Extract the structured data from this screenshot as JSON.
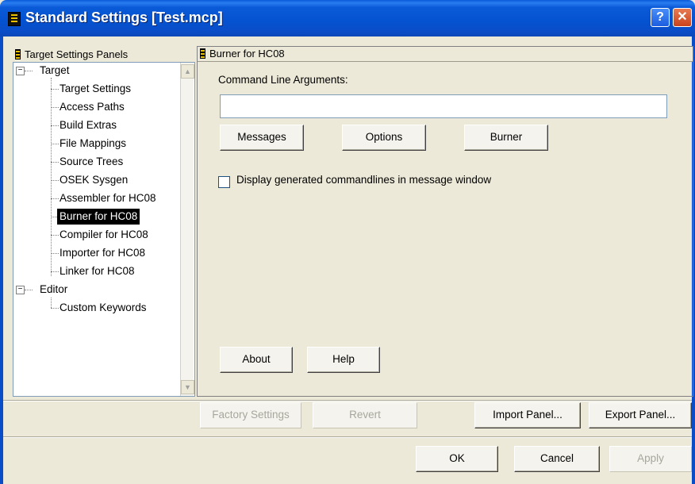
{
  "window": {
    "title": "Standard Settings [Test.mcp]",
    "help_glyph": "?",
    "close_glyph": "✕"
  },
  "left_panel": {
    "header": "Target Settings Panels",
    "tree": [
      {
        "label": "Target",
        "level": 0,
        "expander": "−"
      },
      {
        "label": "Target Settings",
        "level": 1
      },
      {
        "label": "Access Paths",
        "level": 1
      },
      {
        "label": "Build Extras",
        "level": 1
      },
      {
        "label": "File Mappings",
        "level": 1
      },
      {
        "label": "Source Trees",
        "level": 1
      },
      {
        "label": "OSEK Sysgen",
        "level": 1
      },
      {
        "label": "Assembler for HC08",
        "level": 1
      },
      {
        "label": "Burner for HC08",
        "level": 1,
        "selected": true
      },
      {
        "label": "Compiler for HC08",
        "level": 1
      },
      {
        "label": "Importer for HC08",
        "level": 1
      },
      {
        "label": "Linker for HC08",
        "level": 1
      },
      {
        "label": "Editor",
        "level": 0,
        "expander": "−"
      },
      {
        "label": "Custom Keywords",
        "level": 1
      }
    ]
  },
  "right_panel": {
    "header": "Burner for HC08",
    "cmd_label": "Command Line Arguments:",
    "cmd_value": "",
    "buttons": {
      "messages": "Messages",
      "options": "Options",
      "burner": "Burner",
      "about": "About",
      "help": "Help"
    },
    "checkbox_label": "Display generated commandlines in message window",
    "checkbox_checked": false
  },
  "bottom": {
    "factory_settings": "Factory Settings",
    "revert": "Revert",
    "import_panel": "Import Panel...",
    "export_panel": "Export Panel...",
    "ok": "OK",
    "cancel": "Cancel",
    "apply": "Apply"
  }
}
